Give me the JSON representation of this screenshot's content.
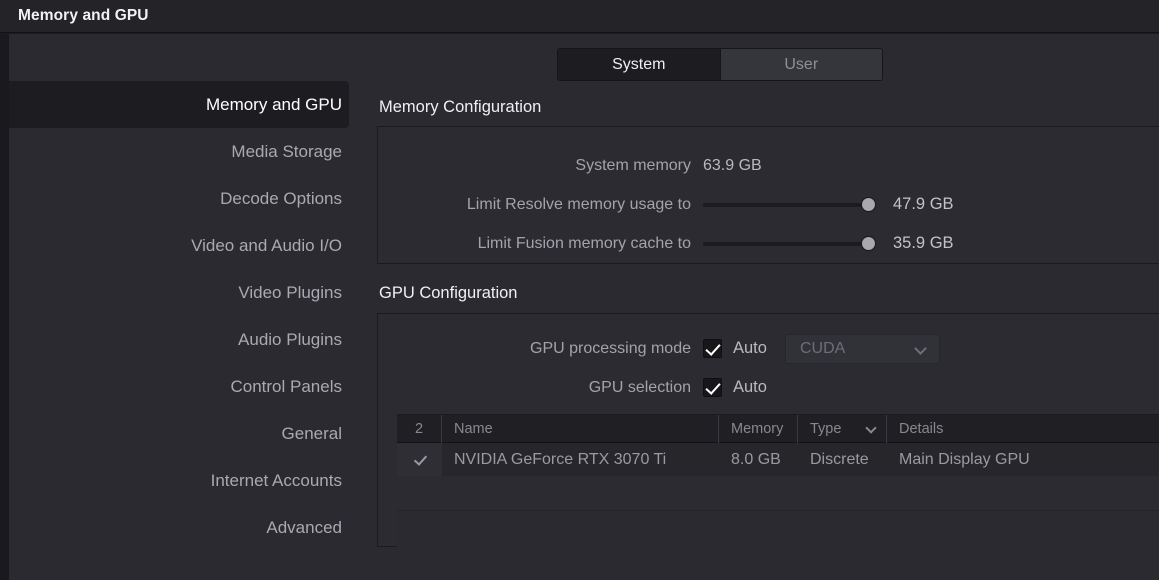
{
  "window": {
    "title": "Memory and GPU"
  },
  "tabs": [
    {
      "label": "System",
      "active": true
    },
    {
      "label": "User",
      "active": false
    }
  ],
  "sidebar": {
    "items": [
      {
        "label": "Memory and GPU",
        "active": true
      },
      {
        "label": "Media Storage",
        "active": false
      },
      {
        "label": "Decode Options",
        "active": false
      },
      {
        "label": "Video and Audio I/O",
        "active": false
      },
      {
        "label": "Video Plugins",
        "active": false
      },
      {
        "label": "Audio Plugins",
        "active": false
      },
      {
        "label": "Control Panels",
        "active": false
      },
      {
        "label": "General",
        "active": false
      },
      {
        "label": "Internet Accounts",
        "active": false
      },
      {
        "label": "Advanced",
        "active": false
      }
    ]
  },
  "memory": {
    "section_title": "Memory Configuration",
    "system_memory_label": "System memory",
    "system_memory_value": "63.9 GB",
    "resolve_limit_label": "Limit Resolve memory usage to",
    "resolve_limit_value": "47.9 GB",
    "fusion_limit_label": "Limit Fusion memory cache to",
    "fusion_limit_value": "35.9 GB"
  },
  "gpu": {
    "section_title": "GPU Configuration",
    "processing_mode_label": "GPU processing mode",
    "processing_mode_auto": "Auto",
    "processing_mode_value": "CUDA",
    "selection_label": "GPU selection",
    "selection_auto": "Auto",
    "table": {
      "headers": {
        "count": "2",
        "name": "Name",
        "memory": "Memory",
        "type": "Type",
        "details": "Details"
      },
      "rows": [
        {
          "checked": true,
          "name": "NVIDIA GeForce RTX 3070 Ti",
          "memory": "8.0 GB",
          "type": "Discrete",
          "details": "Main Display GPU"
        }
      ]
    }
  },
  "colors": {
    "window_bg": "#2a2a30",
    "titlebar_bg": "#232328",
    "selected_bg": "#1c1c21",
    "text_primary": "#f0f0f2",
    "text_secondary": "#a3a3aa"
  }
}
